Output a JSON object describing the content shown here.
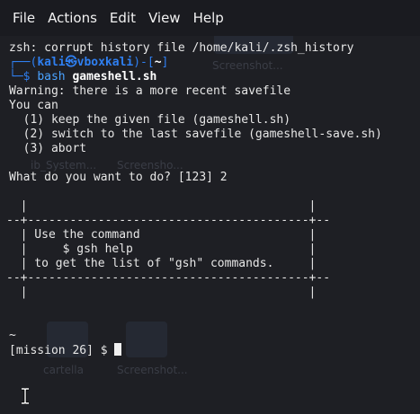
{
  "menubar": {
    "items": [
      "File",
      "Actions",
      "Edit",
      "View",
      "Help"
    ]
  },
  "terminal": {
    "line_history": "zsh: corrupt history file /home/kali/.zsh_history",
    "prompt_open": "┌──(",
    "prompt_user": "kali㉿vboxkali",
    "prompt_mid": ")-[",
    "prompt_path": "~",
    "prompt_close": "]",
    "prompt_arrow": "└─$ ",
    "cmd_bash": "bash ",
    "cmd_script": "gameshell.sh",
    "warning": "Warning: there is a more recent savefile",
    "you_can": "You can",
    "option1": "  (1) keep the given file (gameshell.sh)",
    "option2": "  (2) switch to the last savefile (gameshell-save.sh)",
    "option3": "  (3) abort",
    "question": "What do you want to do? [123] 2",
    "box_top": "  |                                        |",
    "box_sep1": "--+----------------------------------------+--",
    "box_l1": "  | Use the command                        |",
    "box_l2": "  |     $ gsh help                         |",
    "box_l3": "  | to get the list of \"gsh\" commands.     |",
    "box_sep2": "--+----------------------------------------+--",
    "box_bottom": "  |                                        |",
    "tilde": "~",
    "mission_prompt": "[mission 26] $ "
  },
  "desktop_ghosts": [
    "Screenshot...",
    "ib_System...",
    "Screensho...",
    "cartella",
    "Screenshot..."
  ],
  "colors": {
    "background": "#1e1f24",
    "prompt_blue": "#2f7ff0",
    "text": "#e7e7e7"
  }
}
